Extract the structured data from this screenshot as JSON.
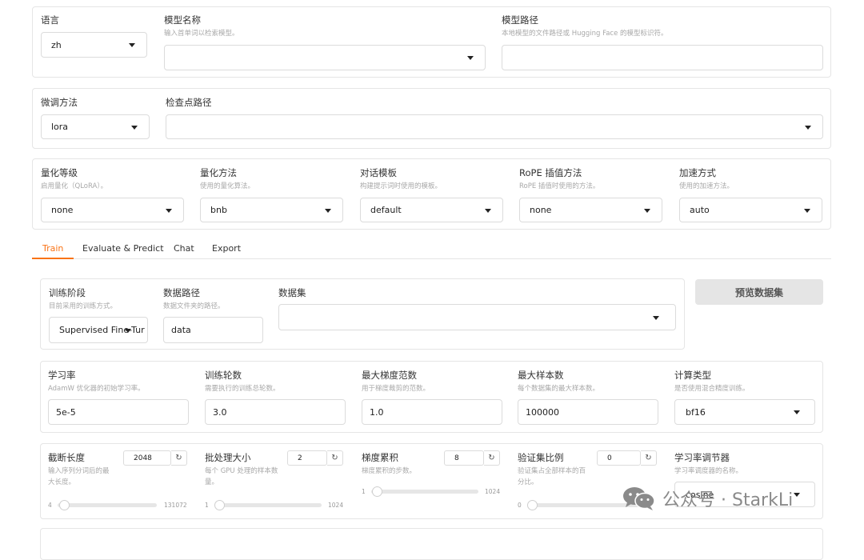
{
  "top": {
    "lang_label": "语言",
    "lang_value": "zh",
    "model_name_label": "模型名称",
    "model_name_info": "输入首单词以检索模型。",
    "model_path_label": "模型路径",
    "model_path_info": "本地模型的文件路径或 Hugging Face 的模型标识符。"
  },
  "finetune": {
    "method_label": "微调方法",
    "method_value": "lora",
    "checkpoint_label": "检查点路径"
  },
  "advanced": {
    "quant_bit_label": "量化等级",
    "quant_bit_info": "启用量化（QLoRA）。",
    "quant_bit_value": "none",
    "quant_method_label": "量化方法",
    "quant_method_info": "使用的量化算法。",
    "quant_method_value": "bnb",
    "template_label": "对话模板",
    "template_info": "构建提示词时使用的模板。",
    "template_value": "default",
    "rope_label": "RoPE 插值方法",
    "rope_info": "RoPE 插值时使用的方法。",
    "rope_value": "none",
    "booster_label": "加速方式",
    "booster_info": "使用的加速方法。",
    "booster_value": "auto"
  },
  "tabs": [
    "Train",
    "Evaluate & Predict",
    "Chat",
    "Export"
  ],
  "train": {
    "stage_label": "训练阶段",
    "stage_info": "目前采用的训练方式。",
    "stage_value": "Supervised Fine-Tur",
    "dataset_dir_label": "数据路径",
    "dataset_dir_info": "数据文件夹的路径。",
    "dataset_dir_value": "data",
    "dataset_label": "数据集",
    "preview_button": "预览数据集",
    "lr_label": "学习率",
    "lr_info": "AdamW 优化器的初始学习率。",
    "lr_value": "5e-5",
    "epochs_label": "训练轮数",
    "epochs_info": "需要执行的训练总轮数。",
    "epochs_value": "3.0",
    "max_grad_label": "最大梯度范数",
    "max_grad_info": "用于梯度裁剪的范数。",
    "max_grad_value": "1.0",
    "max_samples_label": "最大样本数",
    "max_samples_info": "每个数据集的最大样本数。",
    "max_samples_value": "100000",
    "compute_label": "计算类型",
    "compute_info": "是否使用混合精度训练。",
    "compute_value": "bf16",
    "cutoff_label": "截断长度",
    "cutoff_info_1": "输入序列分词后的最",
    "cutoff_info_2": "大长度。",
    "cutoff_value": "2048",
    "cutoff_min": "4",
    "cutoff_max": "131072",
    "cutoff_fraction": 0.0156,
    "batch_label": "批处理大小",
    "batch_info_1": "每个 GPU 处理的样本数",
    "batch_info_2": "量。",
    "batch_value": "2",
    "batch_min": "1",
    "batch_max": "1024",
    "batch_fraction": 0.001,
    "grad_acc_label": "梯度累积",
    "grad_acc_info": "梯度累积的步数。",
    "grad_acc_value": "8",
    "grad_acc_min": "1",
    "grad_acc_max": "1024",
    "grad_acc_fraction": 0.007,
    "val_label": "验证集比例",
    "val_info_1": "验证集占全部样本的百",
    "val_info_2": "分比。",
    "val_value": "0",
    "val_min": "0",
    "val_fraction": 0,
    "scheduler_label": "学习率调节器",
    "scheduler_info": "学习率调度器的名称。",
    "scheduler_value": "cosine"
  },
  "watermark": "公众号 · StarkLi",
  "colors": {
    "accent": "#f97316",
    "button_bg": "#e5e5e5",
    "border": "#e5e5e5"
  }
}
